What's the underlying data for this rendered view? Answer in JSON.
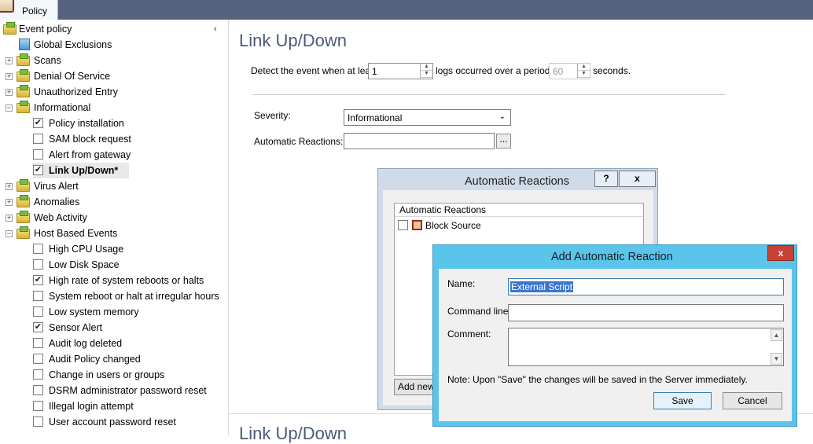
{
  "tab": {
    "label": "Policy"
  },
  "tree": {
    "root_label": "Event policy",
    "collapse_glyph": "‹",
    "items": [
      {
        "label": "Global Exclusions",
        "kind": "doc"
      },
      {
        "label": "Scans",
        "kind": "folder",
        "expander": "+"
      },
      {
        "label": "Denial Of Service",
        "kind": "folder",
        "expander": "+"
      },
      {
        "label": "Unauthorized Entry",
        "kind": "folder",
        "expander": "+"
      },
      {
        "label": "Informational",
        "kind": "folder",
        "expander": "−"
      },
      {
        "label": "Policy installation",
        "kind": "check",
        "checked": true
      },
      {
        "label": "SAM block request",
        "kind": "check",
        "checked": false
      },
      {
        "label": "Alert from gateway",
        "kind": "check",
        "checked": false
      },
      {
        "label": "Link Up/Down*",
        "kind": "check",
        "checked": true,
        "selected": true
      },
      {
        "label": "Virus Alert",
        "kind": "folder",
        "expander": "+"
      },
      {
        "label": "Anomalies",
        "kind": "folder",
        "expander": "+"
      },
      {
        "label": "Web Activity",
        "kind": "folder",
        "expander": "+"
      },
      {
        "label": "Host Based Events",
        "kind": "folder",
        "expander": "−"
      },
      {
        "label": "High CPU Usage",
        "kind": "check",
        "checked": false
      },
      {
        "label": "Low Disk Space",
        "kind": "check",
        "checked": false
      },
      {
        "label": "High rate of system reboots or halts",
        "kind": "check",
        "checked": true
      },
      {
        "label": "System reboot or halt at irregular hours",
        "kind": "check",
        "checked": false
      },
      {
        "label": "Low system memory",
        "kind": "check",
        "checked": false
      },
      {
        "label": "Sensor Alert",
        "kind": "check",
        "checked": true
      },
      {
        "label": "Audit log deleted",
        "kind": "check",
        "checked": false
      },
      {
        "label": "Audit Policy changed",
        "kind": "check",
        "checked": false
      },
      {
        "label": "Change in users or groups",
        "kind": "check",
        "checked": false
      },
      {
        "label": "DSRM administrator password reset",
        "kind": "check",
        "checked": false
      },
      {
        "label": "Illegal login attempt",
        "kind": "check",
        "checked": false
      },
      {
        "label": "User account password reset",
        "kind": "check",
        "checked": false
      }
    ]
  },
  "main": {
    "title": "Link Up/Down",
    "detect_prefix": "Detect the event when at least",
    "logs_value": "1",
    "detect_middle": "logs occurred over a period of",
    "period_value": "60",
    "detect_suffix": "seconds.",
    "severity_label": "Severity:",
    "severity_value": "Informational",
    "reactions_label": "Automatic Reactions:",
    "reactions_value": "",
    "browse_label": "...",
    "lower_title": "Link Up/Down"
  },
  "dialog_reactions": {
    "title": "Automatic Reactions",
    "help_label": "?",
    "close_label": "x",
    "list_header": "Automatic Reactions",
    "items": [
      {
        "label": "Block Source",
        "checked": false
      }
    ],
    "add_new_label": "Add new..."
  },
  "dialog_add": {
    "title": "Add Automatic Reaction",
    "close_label": "x",
    "name_label": "Name:",
    "name_value": "External Script",
    "command_label": "Command line:",
    "command_value": "",
    "comment_label": "Comment:",
    "comment_value": "",
    "note": "Note:  Upon \"Save\" the changes will be saved in the Server immediately.",
    "save_label": "Save",
    "cancel_label": "Cancel"
  },
  "colors": {
    "topbar": "#55627e",
    "title_text": "#4a5a78",
    "add_dialog_frame": "#5ac4ea",
    "add_dialog_close": "#c64235"
  }
}
